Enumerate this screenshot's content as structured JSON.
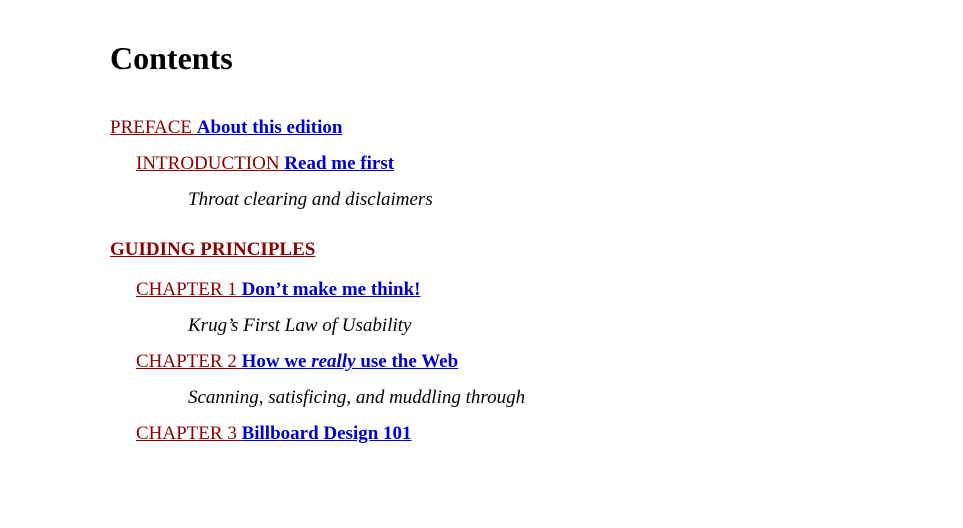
{
  "heading": "Contents",
  "preface": {
    "label": "PREFACE",
    "title": "About this edition"
  },
  "introduction": {
    "label": "INTRODUCTION",
    "title": "Read me first",
    "subtitle": "Throat clearing and disclaimers"
  },
  "section1": {
    "label": "GUIDING PRINCIPLES"
  },
  "chapter1": {
    "label": "CHAPTER 1",
    "title": "Don’t make me think!",
    "subtitle": "Krug’s First Law of Usability"
  },
  "chapter2": {
    "label": "CHAPTER 2",
    "title_pre": "How we ",
    "title_em": "really",
    "title_post": " use the Web",
    "subtitle": "Scanning, satisficing, and muddling through"
  },
  "chapter3": {
    "label": "CHAPTER 3",
    "title": "Billboard Design 101"
  }
}
